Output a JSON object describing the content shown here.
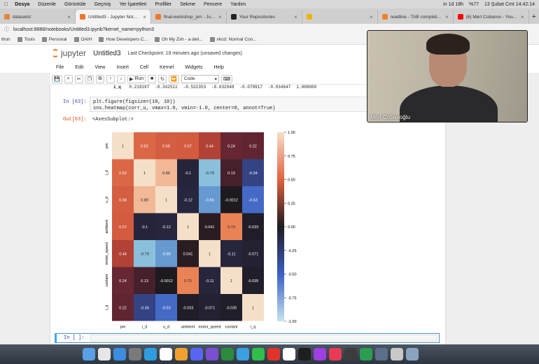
{
  "menubar": {
    "items": [
      "Dosya",
      "Düzenle",
      "Görüntüle",
      "Geçmiş",
      "Yer İşaretleri",
      "Profiller",
      "Sekme",
      "Pencere",
      "Yardım"
    ],
    "status": "in 1d 18h",
    "battery": "%77",
    "datetime": "13 Şubat Cmt  14:42:14"
  },
  "tabs": [
    {
      "title": "datasets/",
      "color": "#e0883a",
      "active": false
    },
    {
      "title": "Untitled3 - Jupyter Notebook",
      "color": "#f37626",
      "active": true
    },
    {
      "title": "final-workshop_pm - Jupyter N",
      "color": "#f37626",
      "active": false
    },
    {
      "title": "Your Repositories",
      "color": "#222222",
      "active": false
    },
    {
      "title": "",
      "color": "#f0b400",
      "active": false
    },
    {
      "title": "readline - TAB completion do...",
      "color": "#f48024",
      "active": false
    },
    {
      "title": "(6) Mert Cobanov - YouTube",
      "color": "#ff0000",
      "active": false
    }
  ],
  "address": {
    "url": "localhost:8888/notebooks/Untitled3.ipynb?kernel_name=python3"
  },
  "bookmarks": [
    "thon",
    "Tools",
    "Personal",
    "OAIH",
    "How Developers C...",
    "Oh My Zsh - a deli...",
    "xkcd: Normal Con..."
  ],
  "jupyter": {
    "logo_text": "jupyter",
    "notebook_name": "Untitled3",
    "checkpoint": "Last Checkpoint: 19 minutes ago",
    "unsaved": "(unsaved changes)",
    "menu": [
      "File",
      "Edit",
      "View",
      "Insert",
      "Cell",
      "Kernel",
      "Widgets",
      "Help"
    ],
    "run_label": "Run",
    "cell_type": "Code",
    "prev_row_label": "i_q",
    "prev_row_values": [
      "0.219197",
      "-0.342511",
      "-0.532353",
      "-0.032948",
      "-0.070917",
      "-0.034647",
      "1.000000"
    ],
    "in_prompt": "In [63]:",
    "code_line1": "plt.figure(figsize=(10, 10))",
    "code_line2": "sns.heatmap(corr_u, vmax=1.0, vmin=-1.0, center=0, annot=True)",
    "out_prompt": "Out[63]:",
    "out_text": "<AxesSubplot:>",
    "next_prompt": "In [ ]:"
  },
  "video": {
    "name": "Mert Çobanoğlu"
  },
  "chart_data": {
    "type": "heatmap",
    "x": [
      "pm",
      "i_d",
      "u_d",
      "ambient",
      "motor_speed",
      "coolant",
      "i_q"
    ],
    "y": [
      "pm",
      "i_d",
      "u_d",
      "ambient",
      "motor_speed",
      "coolant",
      "i_q"
    ],
    "values": [
      [
        1,
        0.62,
        0.58,
        0.57,
        0.44,
        0.24,
        0.22
      ],
      [
        0.62,
        1,
        0.89,
        -0.1,
        -0.79,
        0.13,
        -0.34
      ],
      [
        0.58,
        0.89,
        1,
        -0.12,
        -0.66,
        -0.0012,
        -0.53
      ],
      [
        0.57,
        -0.1,
        -0.12,
        1,
        0.041,
        0.73,
        -0.033
      ],
      [
        0.44,
        -0.79,
        -0.66,
        0.041,
        1,
        -0.11,
        -0.071
      ],
      [
        0.24,
        0.13,
        -0.0012,
        0.73,
        -0.11,
        1,
        -0.035
      ],
      [
        0.22,
        -0.34,
        -0.53,
        -0.033,
        -0.071,
        -0.035,
        1
      ]
    ],
    "annotations": [
      [
        "1",
        "0.62",
        "0.58",
        "0.57",
        "0.44",
        "0.24",
        "0.22"
      ],
      [
        "0.62",
        "1",
        "0.89",
        "-0.1",
        "-0.79",
        "0.13",
        "-0.34"
      ],
      [
        "0.58",
        "0.89",
        "1",
        "-0.12",
        "-0.66",
        "-0.0012",
        "-0.53"
      ],
      [
        "0.57",
        "-0.1",
        "-0.12",
        "1",
        "0.041",
        "0.73",
        "-0.033"
      ],
      [
        "0.44",
        "-0.79",
        "-0.66",
        "0.041",
        "1",
        "-0.11",
        "-0.071"
      ],
      [
        "0.24",
        "0.13",
        "-0.0012",
        "0.73",
        "-0.11",
        "1",
        "-0.035"
      ],
      [
        "0.22",
        "-0.34",
        "-0.53",
        "-0.033",
        "-0.071",
        "-0.035",
        "1"
      ]
    ],
    "vmin": -1.0,
    "vmax": 1.0,
    "center": 0,
    "colorbar_ticks": [
      "1.00",
      "0.75",
      "0.50",
      "0.25",
      "0.00",
      "-0.25",
      "-0.50",
      "-0.75",
      "-1.00"
    ],
    "colorbar_values": [
      1.0,
      0.75,
      0.5,
      0.25,
      0.0,
      -0.25,
      -0.5,
      -0.75,
      -1.0
    ]
  }
}
